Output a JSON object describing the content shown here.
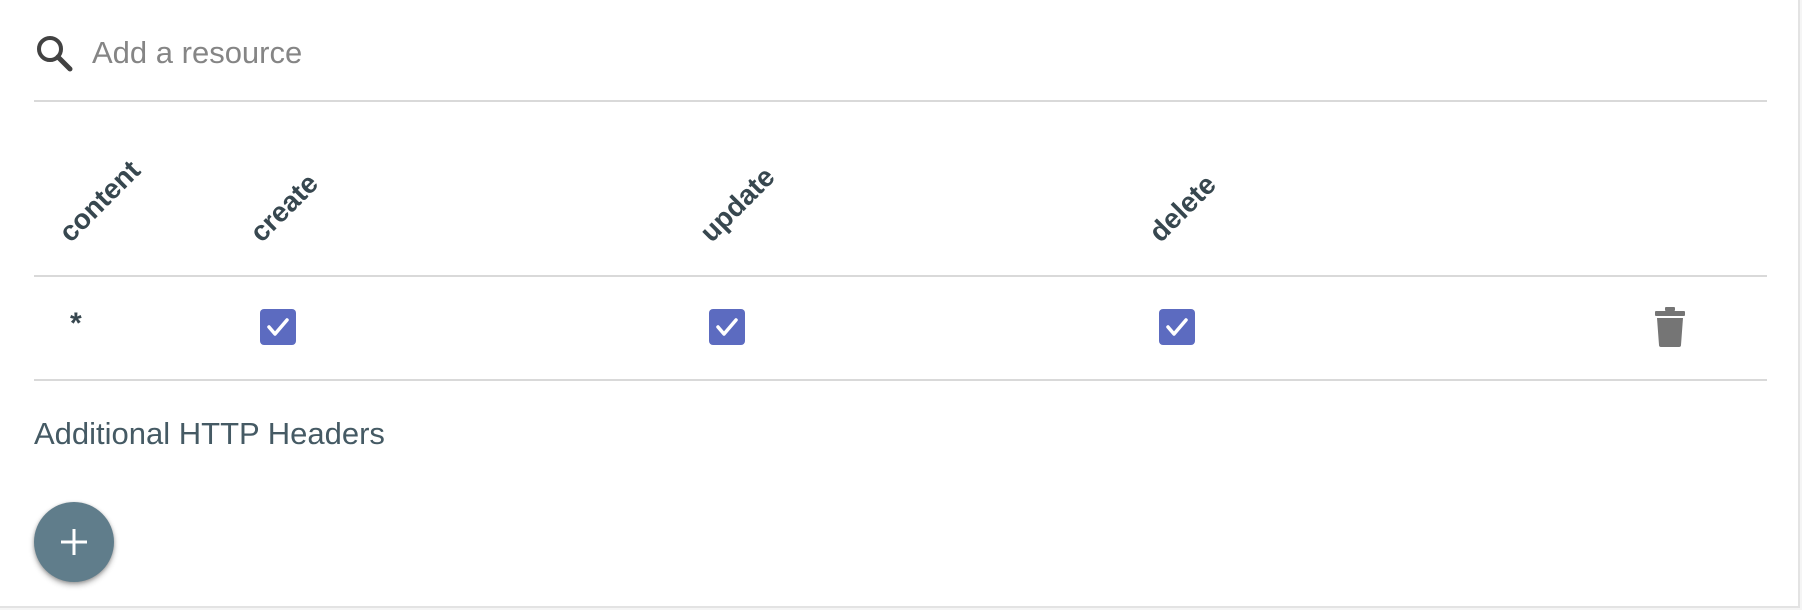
{
  "search": {
    "placeholder": "Add a resource",
    "icon": "search-icon"
  },
  "permissions_table": {
    "columns": [
      "content",
      "create",
      "update",
      "delete"
    ],
    "rows": [
      {
        "resource": "*",
        "create": true,
        "update": true,
        "delete": true,
        "action_icon": "trash-icon"
      }
    ]
  },
  "headers_section": {
    "title": "Additional HTTP Headers",
    "add_icon": "plus-icon"
  },
  "colors": {
    "checkbox": "#5c6bc0",
    "fab": "#607d8b",
    "header_text": "#37474f",
    "section_text": "#455a64",
    "divider": "#d9d9d9",
    "trash": "#757575"
  }
}
